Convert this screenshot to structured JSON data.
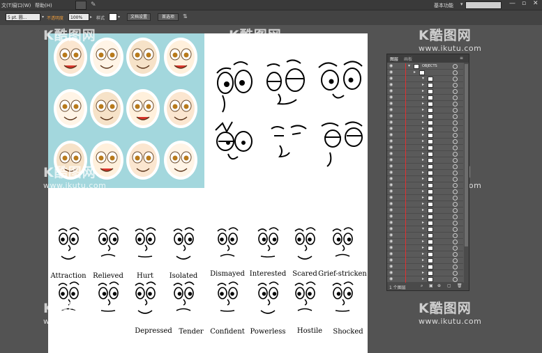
{
  "menubar": {
    "items": [
      "文(T)",
      "窗口(W)",
      "帮助(H)"
    ],
    "workspace": "基本功能",
    "search_placeholder": ""
  },
  "control_bar": {
    "stroke_label": "5 pt. 圆...",
    "opacity_label": "不透明度",
    "opacity_value": "100%",
    "style_label": "样式",
    "doc_setup": "文档设置",
    "preferences": "首选项"
  },
  "watermark": {
    "logo": "K酷图网",
    "url": "www.ikutu.com"
  },
  "layers_panel": {
    "tabs": [
      "图层",
      "画板"
    ],
    "top_layer": "OBJECTS",
    "footer_text": "1 个图层",
    "accent_color": "#e03030"
  },
  "faces": {
    "row1": [
      "Attraction",
      "Relieved",
      "Hurt",
      "Isolated",
      "Dismayed",
      "Interested",
      "Scared",
      "Grief-stricken"
    ],
    "row2": [
      "",
      "",
      "Depressed",
      "Tender",
      "Confident",
      "Powerless",
      "Hostile",
      "Shocked"
    ]
  }
}
